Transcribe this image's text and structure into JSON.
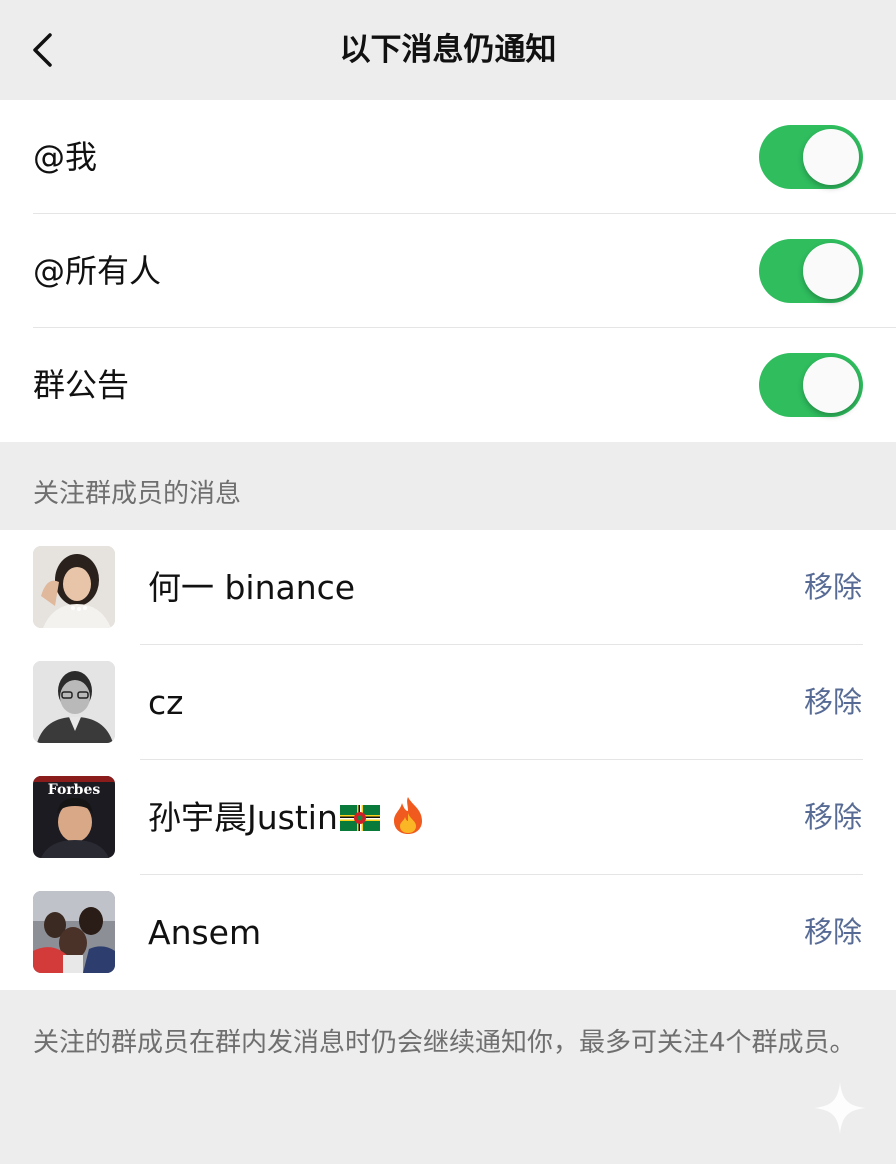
{
  "nav": {
    "title": "以下消息仍通知",
    "back_icon": "chevron-left-icon"
  },
  "switches": [
    {
      "label": "@我",
      "on": true
    },
    {
      "label": "@所有人",
      "on": true
    },
    {
      "label": "群公告",
      "on": true
    }
  ],
  "colors": {
    "toggle_on": "#2fbd5e",
    "link": "#576b95",
    "background": "#ededed"
  },
  "members_section": {
    "header": "关注群成员的消息"
  },
  "members": [
    {
      "name": "何一 binance",
      "action": "移除",
      "avatar": "woman-portrait-avatar"
    },
    {
      "name": "cz",
      "action": "移除",
      "avatar": "man-glasses-sketch-avatar"
    },
    {
      "name": "孙宇晨Justin",
      "action": "移除",
      "avatar": "forbes-cover-avatar",
      "avatar_text": "Forbes",
      "emoji": [
        "dominica-flag-icon",
        "fire-icon"
      ]
    },
    {
      "name": "Ansem",
      "action": "移除",
      "avatar": "crowd-photo-avatar"
    }
  ],
  "footer": {
    "note": "关注的群成员在群内发消息时仍会继续通知你，最多可关注4个群成员。"
  }
}
